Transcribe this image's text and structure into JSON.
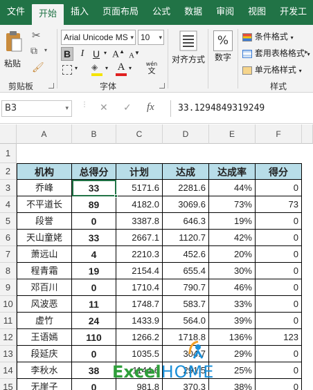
{
  "ribbon_tabs": [
    "文件",
    "开始",
    "插入",
    "页面布局",
    "公式",
    "数据",
    "审阅",
    "视图",
    "开发工"
  ],
  "active_tab": "开始",
  "clipboard": {
    "paste_label": "粘贴",
    "group_label": "剪贴板"
  },
  "font": {
    "name": "Arial Unicode MS",
    "size": "10",
    "group_label": "字体",
    "bold": "B",
    "italic": "I",
    "underline": "U",
    "font_color_glyph": "A",
    "phonetic_glyph": "wén"
  },
  "alignment": {
    "label": "对齐方式"
  },
  "number": {
    "label": "数字",
    "glyph": "%"
  },
  "styles": {
    "conditional": "条件格式",
    "table": "套用表格格式",
    "cell": "单元格样式",
    "group_label": "样式"
  },
  "formula_bar": {
    "name_box": "B3",
    "cancel": "✕",
    "enter": "✓",
    "fx": "fx",
    "value": "33.1294849319249"
  },
  "columns": [
    "A",
    "B",
    "C",
    "D",
    "E",
    "F"
  ],
  "rows": [
    "1",
    "2",
    "3",
    "4",
    "5",
    "6",
    "7",
    "8",
    "9",
    "10",
    "11",
    "12",
    "13",
    "14",
    "15"
  ],
  "table": {
    "headers": [
      "机构",
      "总得分",
      "计划",
      "达成",
      "达成率",
      "得分"
    ],
    "rows": [
      [
        "乔峰",
        "33",
        "5171.6",
        "2281.6",
        "44%",
        "0"
      ],
      [
        "不平道长",
        "89",
        "4182.0",
        "3069.6",
        "73%",
        "73"
      ],
      [
        "段誉",
        "0",
        "3387.8",
        "646.3",
        "19%",
        "0"
      ],
      [
        "天山童姥",
        "33",
        "2667.1",
        "1120.7",
        "42%",
        "0"
      ],
      [
        "萧远山",
        "4",
        "2210.3",
        "452.6",
        "20%",
        "0"
      ],
      [
        "程青霜",
        "19",
        "2154.4",
        "655.4",
        "30%",
        "0"
      ],
      [
        "邓百川",
        "0",
        "1710.4",
        "790.7",
        "46%",
        "0"
      ],
      [
        "风波恶",
        "11",
        "1748.7",
        "583.7",
        "33%",
        "0"
      ],
      [
        "虚竹",
        "24",
        "1433.9",
        "564.0",
        "39%",
        "0"
      ],
      [
        "王语嫣",
        "110",
        "1266.2",
        "1718.8",
        "136%",
        "123"
      ],
      [
        "段延庆",
        "0",
        "1035.5",
        "304.7",
        "29%",
        "0"
      ],
      [
        "李秋水",
        "38",
        "1144.6",
        "291.5",
        "25%",
        "0"
      ],
      [
        "无崖子",
        "0",
        "981.8",
        "370.3",
        "38%",
        "0"
      ]
    ]
  },
  "watermark": {
    "part1": "Excel",
    "part2": "HOME"
  },
  "colors": {
    "ribbon_green": "#217346",
    "header_fill": "#b8dde8",
    "logo_green": "#2e9e3a",
    "logo_blue": "#1b8fd8"
  }
}
